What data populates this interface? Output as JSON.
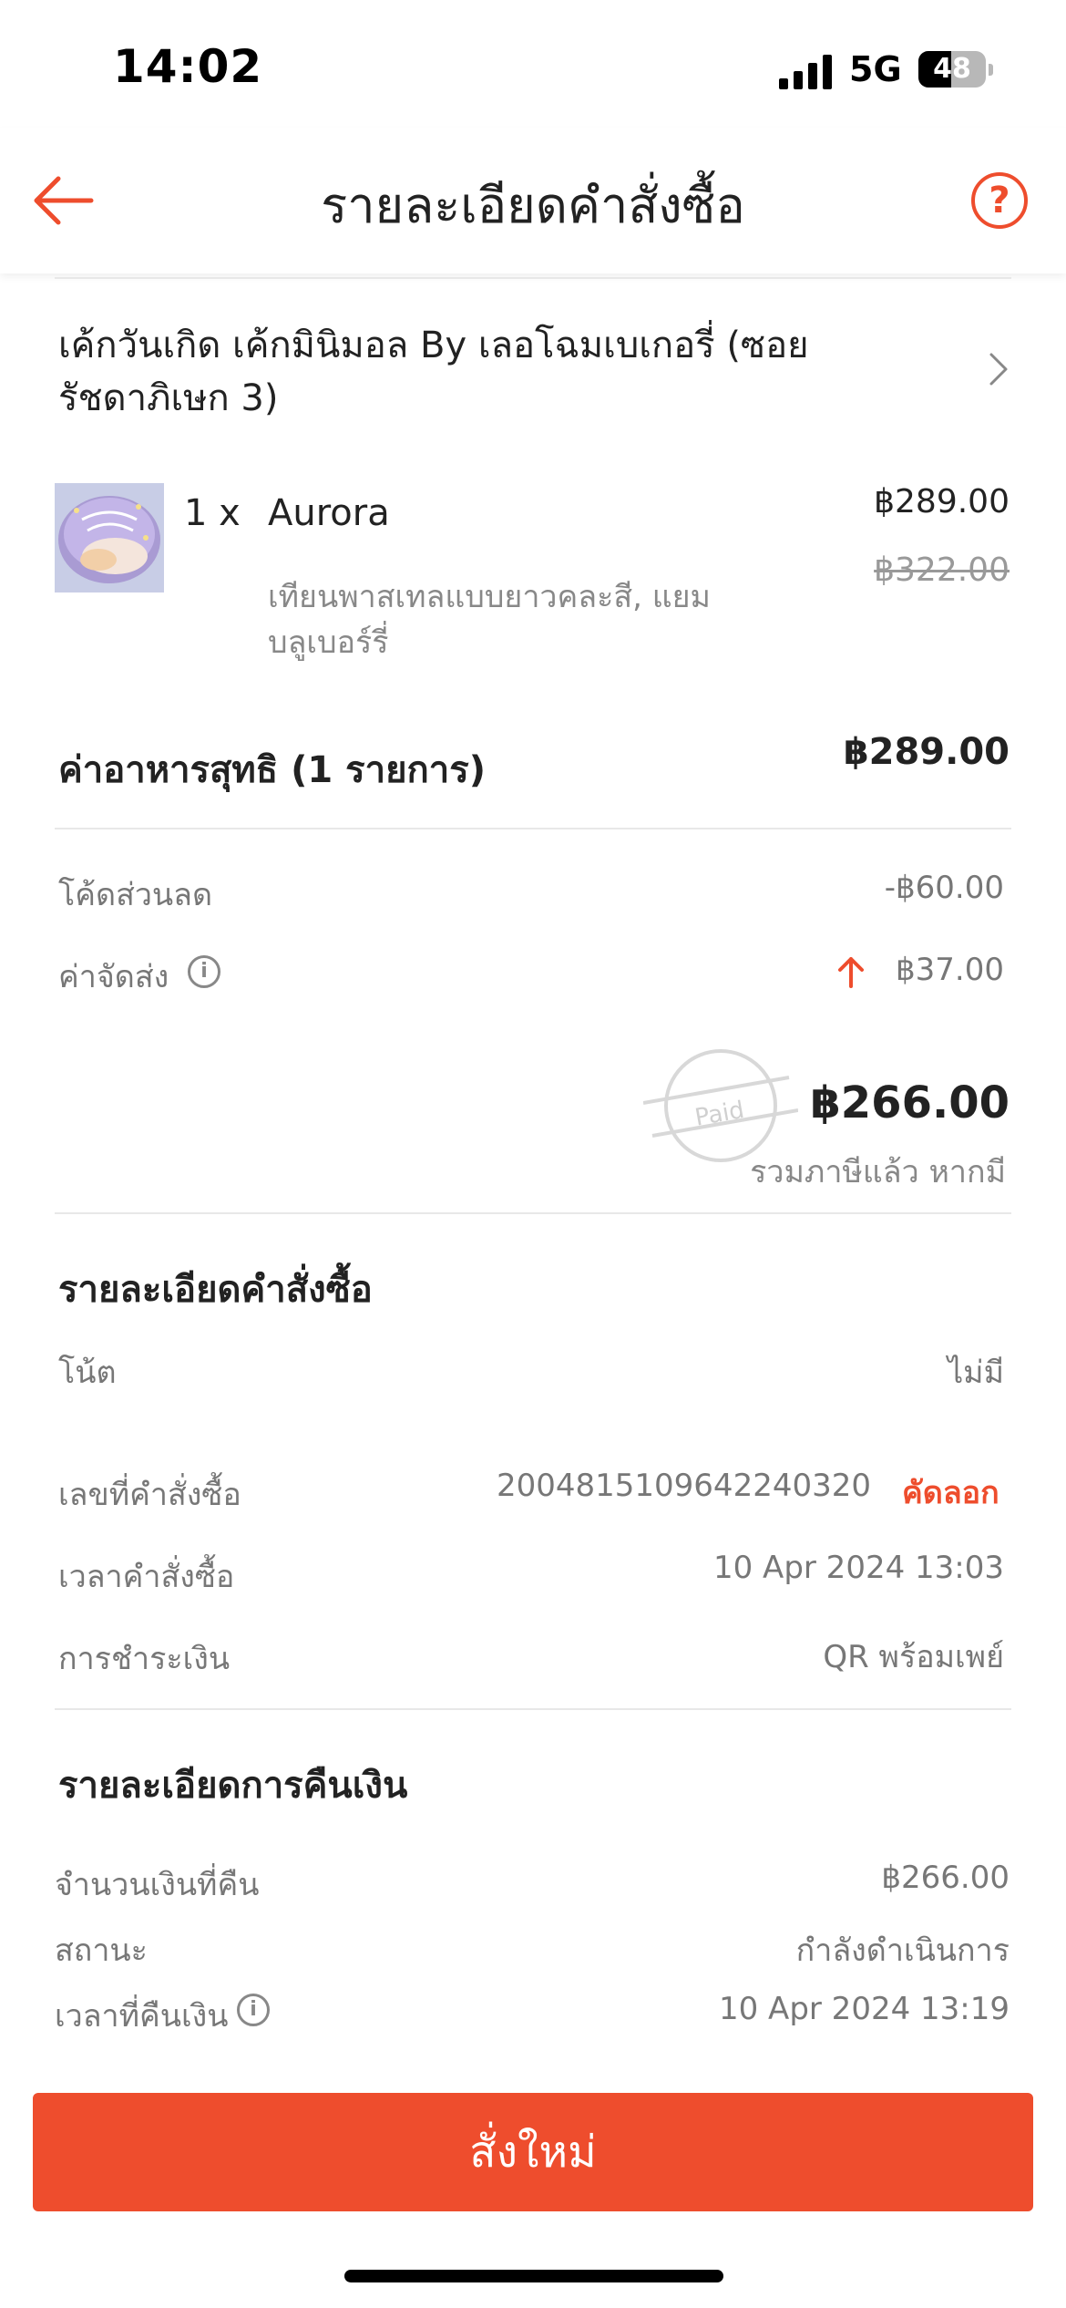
{
  "status_bar": {
    "time": "14:02",
    "network": "5G",
    "battery": "48",
    "battery_level": 0.48
  },
  "header": {
    "title": "รายละเอียดคำสั่งซื้อ",
    "help_label": "?"
  },
  "shop": {
    "name": "เค้กวันเกิด เค้กมินิมอล By เลอโฉมเบเกอรี่ (ซอยรัชดาภิเษก 3)"
  },
  "item": {
    "quantity": "1 x",
    "name": "Aurora",
    "price": "฿289.00",
    "original_price": "฿322.00",
    "options": "เทียนพาสเทลแบบยาวคละสี, แยมบลูเบอร์รี่"
  },
  "summary": {
    "subtotal_label": "ค่าอาหารสุทธิ (1 รายการ)",
    "subtotal_value": "฿289.00",
    "discount_label": "โค้ดส่วนลด",
    "discount_value": "-฿60.00",
    "delivery_label": "ค่าจัดส่ง",
    "delivery_value": "฿37.00",
    "paid_stamp": "Paid",
    "total_value": "฿266.00",
    "total_note": "รวมภาษีแล้ว หากมี"
  },
  "order_details": {
    "title": "รายละเอียดคำสั่งซื้อ",
    "note_label": "โน้ต",
    "note_value": "ไม่มี",
    "order_no_label": "เลขที่คำสั่งซื้อ",
    "order_no_value": "2004815109642240320",
    "copy_label": "คัดลอก",
    "order_time_label": "เวลาคำสั่งซื้อ",
    "order_time_value": "10 Apr 2024 13:03",
    "payment_label": "การชำระเงิน",
    "payment_value": "QR พร้อมเพย์"
  },
  "refund": {
    "title": "รายละเอียดการคืนเงิน",
    "amount_label": "จำนวนเงินที่คืน",
    "amount_value": "฿266.00",
    "status_label": "สถานะ",
    "status_value": "กำลังดำเนินการ",
    "time_label": "เวลาที่คืนเงิน",
    "time_value": "10 Apr 2024 13:19"
  },
  "footer": {
    "reorder_label": "สั่งใหม่"
  },
  "colors": {
    "accent": "#ee4d2d",
    "text": "#222222",
    "muted": "#777777"
  }
}
